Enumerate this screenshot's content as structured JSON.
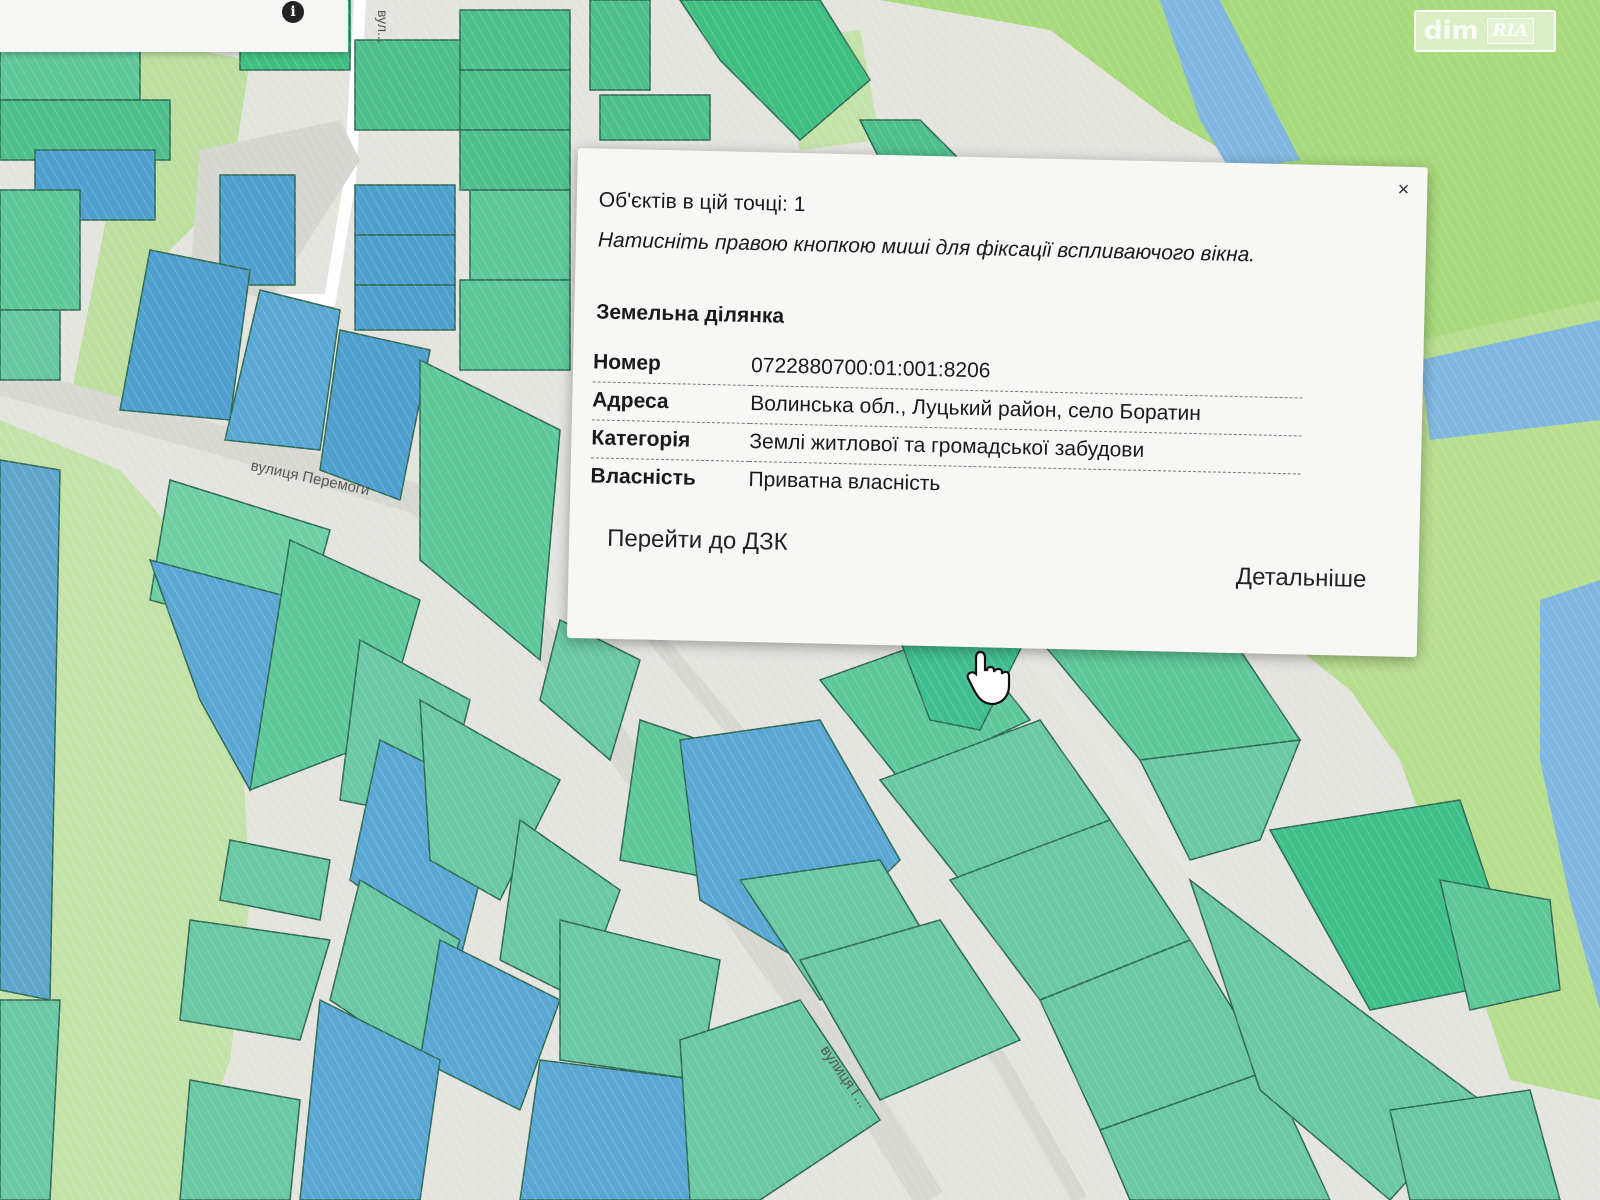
{
  "watermark": {
    "left": "dim",
    "right": "RIA"
  },
  "map": {
    "street_labels": [
      "вулиця Перемоги",
      "вулиця Г...",
      "вул..."
    ],
    "colors": {
      "background": "#e4e4df",
      "grass": "#bfe3a6",
      "field": "#a8d97a",
      "river": "#7fb7e0",
      "parcel_green": "#5ec89a",
      "parcel_blue": "#4f9fcf"
    }
  },
  "toolbar": {
    "info_icon": "info-icon"
  },
  "popup": {
    "close_label": "×",
    "objects_count": "Об'єктів в цій точці: 1",
    "hint": "Натисніть правою кнопкою миші для фіксації вспливаючого вікна.",
    "title": "Земельна ділянка",
    "rows": [
      {
        "key": "Номер",
        "value": "0722880700:01:001:8206"
      },
      {
        "key": "Адреса",
        "value": "Волинська обл., Луцький район, село Боратин"
      },
      {
        "key": "Категорія",
        "value": "Землі житлової та громадської забудови"
      },
      {
        "key": "Власність",
        "value": "Приватна власність"
      }
    ],
    "link_dzk": "Перейти до ДЗК",
    "link_more": "Детальніше"
  }
}
